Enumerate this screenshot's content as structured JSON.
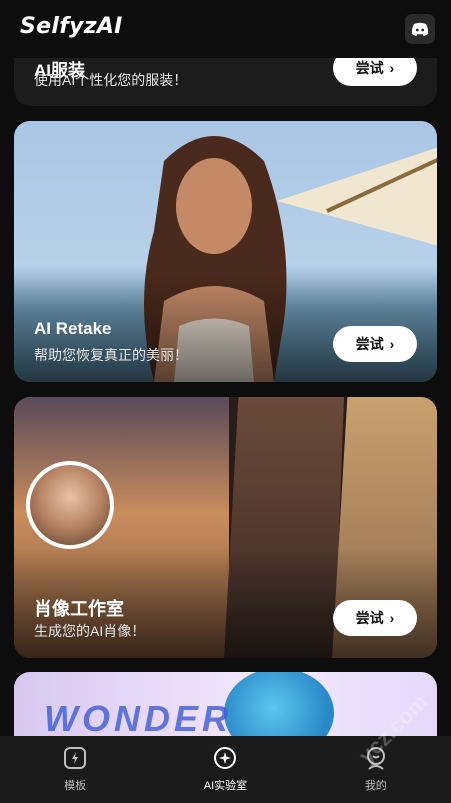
{
  "app": {
    "title": "SelfyzAI"
  },
  "cards": [
    {
      "title": "AI服装",
      "subtitle": "使用AI个性化您的服装！",
      "button": "尝试"
    },
    {
      "title": "AI Retake",
      "subtitle": "帮助您恢复真正的美丽！",
      "button": "尝试"
    },
    {
      "title": "肖像工作室",
      "subtitle": "生成您的AI肖像！",
      "button": "尝试"
    },
    {
      "title": "WONDER ANIMATOR"
    }
  ],
  "bottom_nav": [
    {
      "label": "模板",
      "icon": "template-icon",
      "active": false
    },
    {
      "label": "AI实验室",
      "icon": "ai-lab-icon",
      "active": true
    },
    {
      "label": "我的",
      "icon": "profile-icon",
      "active": false
    }
  ],
  "watermark": "ycz.com"
}
